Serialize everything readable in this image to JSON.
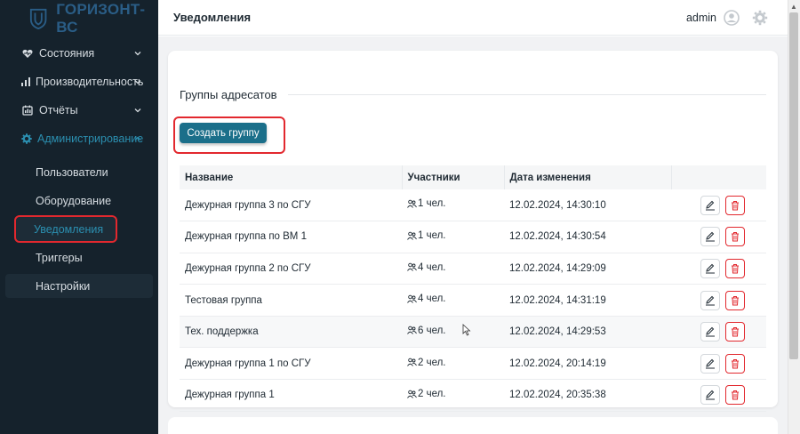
{
  "app": {
    "logo_text": "ГОРИЗОНТ-ВС",
    "brand_color": "#2a5d86"
  },
  "sidebar": {
    "items": [
      {
        "label": "Состояния",
        "icon": "heart-icon"
      },
      {
        "label": "Производительность",
        "icon": "bar-chart-icon"
      },
      {
        "label": "Отчёты",
        "icon": "report-icon"
      },
      {
        "label": "Администрирование",
        "icon": "gear-icon"
      }
    ],
    "subitems": [
      {
        "label": "Пользователи"
      },
      {
        "label": "Оборудование"
      },
      {
        "label": "Уведомления"
      },
      {
        "label": "Триггеры"
      },
      {
        "label": "Настройки"
      }
    ]
  },
  "header": {
    "title": "Уведомления",
    "username": "admin"
  },
  "main": {
    "section_title": "Группы адресатов",
    "create_button": "Создать группу",
    "columns": [
      "Название",
      "Участники",
      "Дата изменения"
    ],
    "rows": [
      {
        "name": "Дежурная группа 3 по СГУ",
        "members": "1 чел.",
        "date": "12.02.2024, 14:30:10"
      },
      {
        "name": "Дежурная группа по ВМ 1",
        "members": "1 чел.",
        "date": "12.02.2024, 14:30:54"
      },
      {
        "name": "Дежурная группа 2 по СГУ",
        "members": "4 чел.",
        "date": "12.02.2024, 14:29:09"
      },
      {
        "name": "Тестовая группа",
        "members": "4 чел.",
        "date": "12.02.2024, 14:31:19"
      },
      {
        "name": "Тех. поддержка",
        "members": "6 чел.",
        "date": "12.02.2024, 14:29:53"
      },
      {
        "name": "Дежурная группа 1 по СГУ",
        "members": "2 чел.",
        "date": "12.02.2024, 20:14:19"
      },
      {
        "name": "Дежурная группа 1",
        "members": "2 чел.",
        "date": "12.02.2024, 20:35:38"
      }
    ]
  },
  "colors": {
    "accent": "#1b6f8a",
    "active_nav": "#2b8fb0",
    "highlight": "#e2282e",
    "sidebar_bg": "#15222c"
  }
}
